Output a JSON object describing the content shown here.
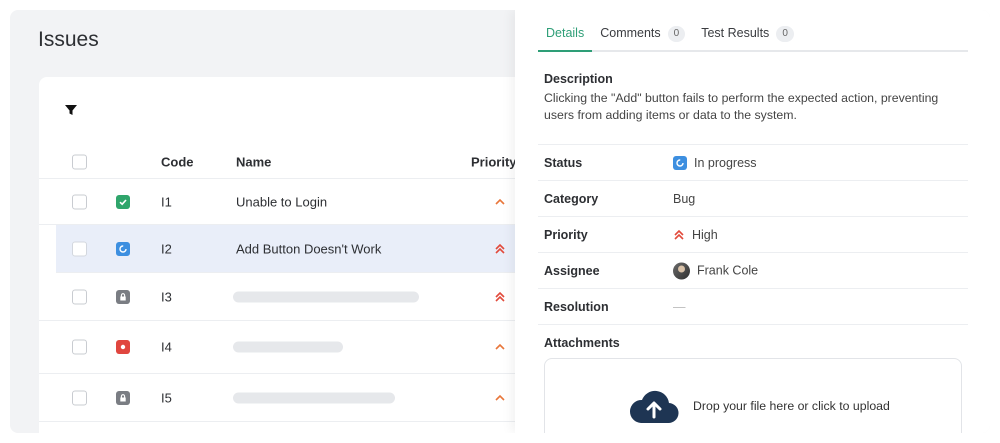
{
  "page": {
    "title": "Issues"
  },
  "table": {
    "columns": {
      "code": "Code",
      "name": "Name",
      "priority": "Priority"
    },
    "rows": [
      {
        "code": "I1",
        "name": "Unable to Login",
        "status": "done",
        "priority": "medium"
      },
      {
        "code": "I2",
        "name": "Add Button Doesn't Work",
        "status": "in-progress",
        "priority": "high"
      },
      {
        "code": "I3",
        "name": "",
        "status": "locked",
        "priority": "high"
      },
      {
        "code": "I4",
        "name": "",
        "status": "blocked",
        "priority": "medium"
      },
      {
        "code": "I5",
        "name": "",
        "status": "locked",
        "priority": "medium"
      }
    ]
  },
  "panel": {
    "tabs": [
      {
        "label": "Details",
        "active": true
      },
      {
        "label": "Comments",
        "count": "0"
      },
      {
        "label": "Test Results",
        "count": "0"
      }
    ],
    "description_label": "Description",
    "description_text": "Clicking the \"Add\" button fails to perform the expected action, preventing users from adding items or data to the system.",
    "fields": {
      "status": {
        "label": "Status",
        "value": "In progress"
      },
      "category": {
        "label": "Category",
        "value": "Bug"
      },
      "priority": {
        "label": "Priority",
        "value": "High"
      },
      "assignee": {
        "label": "Assignee",
        "value": "Frank Cole"
      },
      "resolution": {
        "label": "Resolution",
        "value": "—"
      },
      "attachments": {
        "label": "Attachments"
      }
    },
    "dropzone_text": "Drop your file here or click to upload"
  },
  "colors": {
    "accent": "#2e9e77",
    "done": "#2fa56b",
    "in_progress": "#3d8fe0",
    "locked": "#7a7d83",
    "blocked": "#e0463f",
    "priority": "#e8763a"
  }
}
